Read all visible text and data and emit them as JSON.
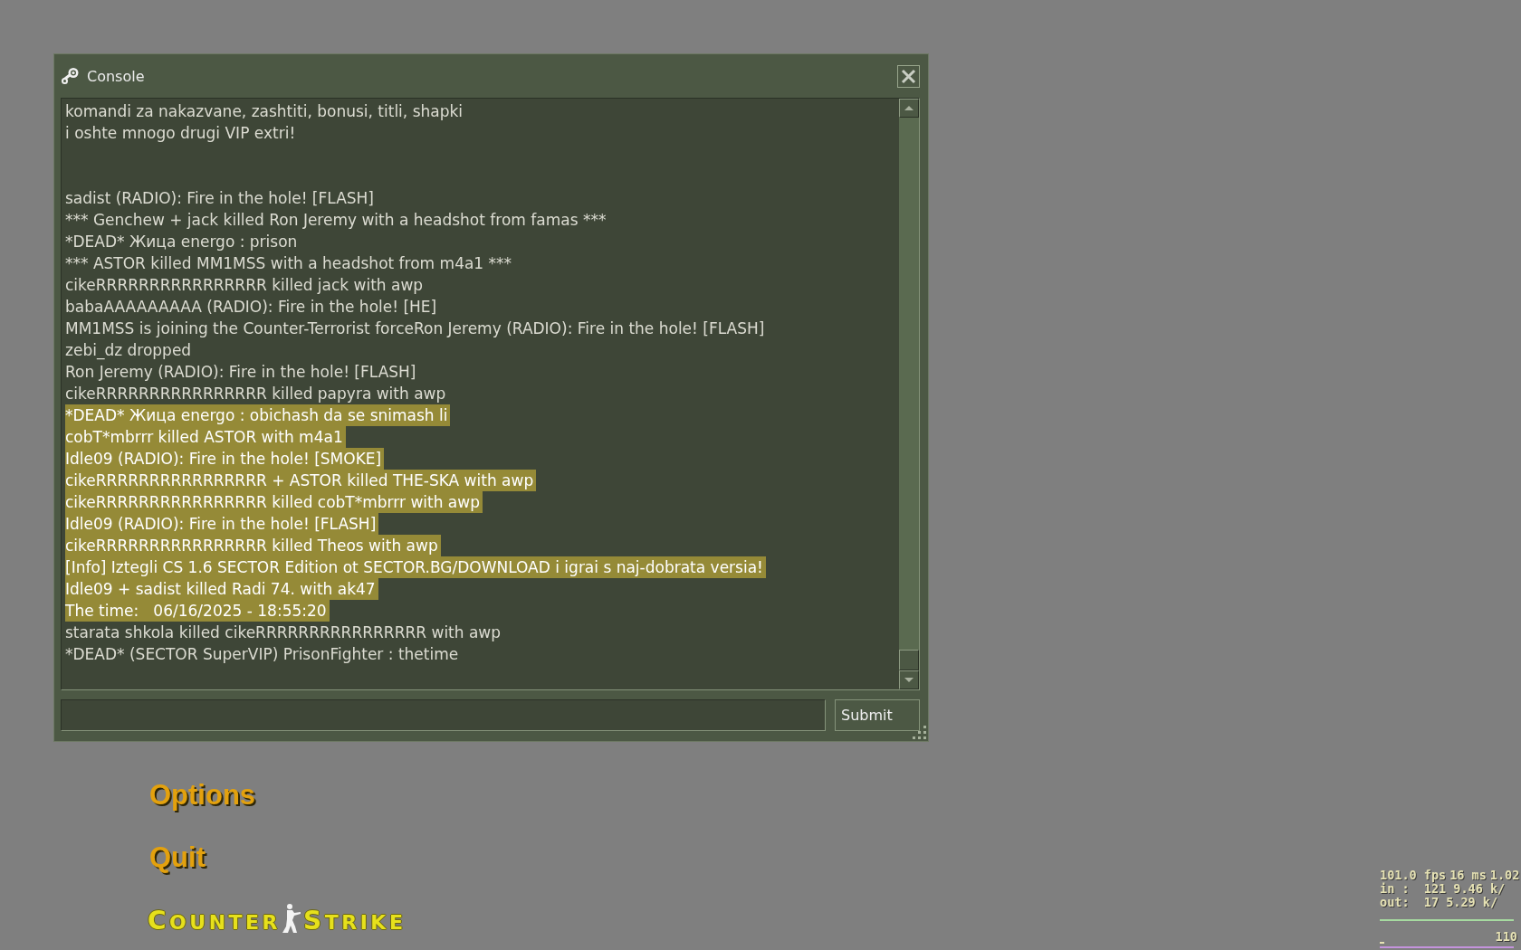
{
  "console": {
    "title": "Console",
    "output": [
      {
        "lines": [
          {
            "text": "komandi za nakazvane, zashtiti, bonusi, titli, shapki",
            "selected": false
          },
          {
            "text": "i oshte mnogo drugi VIP extri!",
            "selected": false
          }
        ]
      },
      {
        "lines": [
          {
            "text": "sadist (RADIO): Fire in the hole! [FLASH]",
            "selected": false
          },
          {
            "text": "*** Genchew + jack killed Ron Jeremy with a headshot from famas ***",
            "selected": false
          },
          {
            "text": "*DEAD* Жица energo : prison",
            "selected": false
          },
          {
            "text": "*** ASTOR killed MM1MSS with a headshot from m4a1 ***",
            "selected": false
          },
          {
            "text": "cikeRRRRRRRRRRRRRRRR killed jack with awp",
            "selected": false
          },
          {
            "text": "babaAAAAAAAAA (RADIO): Fire in the hole! [HE]",
            "selected": false
          },
          {
            "text": "MM1MSS is joining the Counter-Terrorist forceRon Jeremy (RADIO): Fire in the hole! [FLASH]",
            "selected": false
          },
          {
            "text": "zebi_dz dropped",
            "selected": false
          },
          {
            "text": "Ron Jeremy (RADIO): Fire in the hole! [FLASH]",
            "selected": false
          },
          {
            "text": "cikeRRRRRRRRRRRRRRRR killed papyra with awp",
            "selected": false
          },
          {
            "text": "*DEAD* Жица energo : obichash da se snimash li",
            "selected": true
          },
          {
            "text": "cobT*mbrrr killed ASTOR with m4a1",
            "selected": true
          },
          {
            "text": "Idle09 (RADIO): Fire in the hole! [SMOKE]",
            "selected": true
          },
          {
            "text": "cikeRRRRRRRRRRRRRRRR + ASTOR killed THE-SKA with awp",
            "selected": true
          },
          {
            "text": "cikeRRRRRRRRRRRRRRRR killed cobT*mbrrr with awp",
            "selected": true
          },
          {
            "text": "Idle09 (RADIO): Fire in the hole! [FLASH]",
            "selected": true
          },
          {
            "text": "cikeRRRRRRRRRRRRRRRR killed Theos with awp",
            "selected": true
          },
          {
            "text": "[Info] Iztegli CS 1.6 SECTOR Edition ot SECTOR.BG/DOWNLOAD i igrai s naj-dobrata versia!",
            "selected": true
          },
          {
            "text": "Idle09 + sadist killed Radi 74. with ak47",
            "selected": true
          },
          {
            "text": "The time:   06/16/2025 - 18:55:20",
            "selected": true
          },
          {
            "text": "starata shkola killed cikeRRRRRRRRRRRRRRRR with awp",
            "selected": false
          },
          {
            "text": "*DEAD* (SECTOR SuperVIP) PrisonFighter : thetime",
            "selected": false
          }
        ]
      }
    ],
    "submit_label": "Submit"
  },
  "menu": {
    "items": [
      {
        "label": "Options"
      },
      {
        "label": "Quit"
      }
    ]
  },
  "logo": {
    "left": "COUNTER",
    "right": "STRIKE"
  },
  "net_graph": {
    "rows": [
      [
        "101.0 fps",
        "16 ms",
        "1.02"
      ],
      [
        "in :  121 9.46 k/"
      ],
      [
        "out:  17 5.29 k/"
      ]
    ],
    "graph_label": "110"
  }
}
